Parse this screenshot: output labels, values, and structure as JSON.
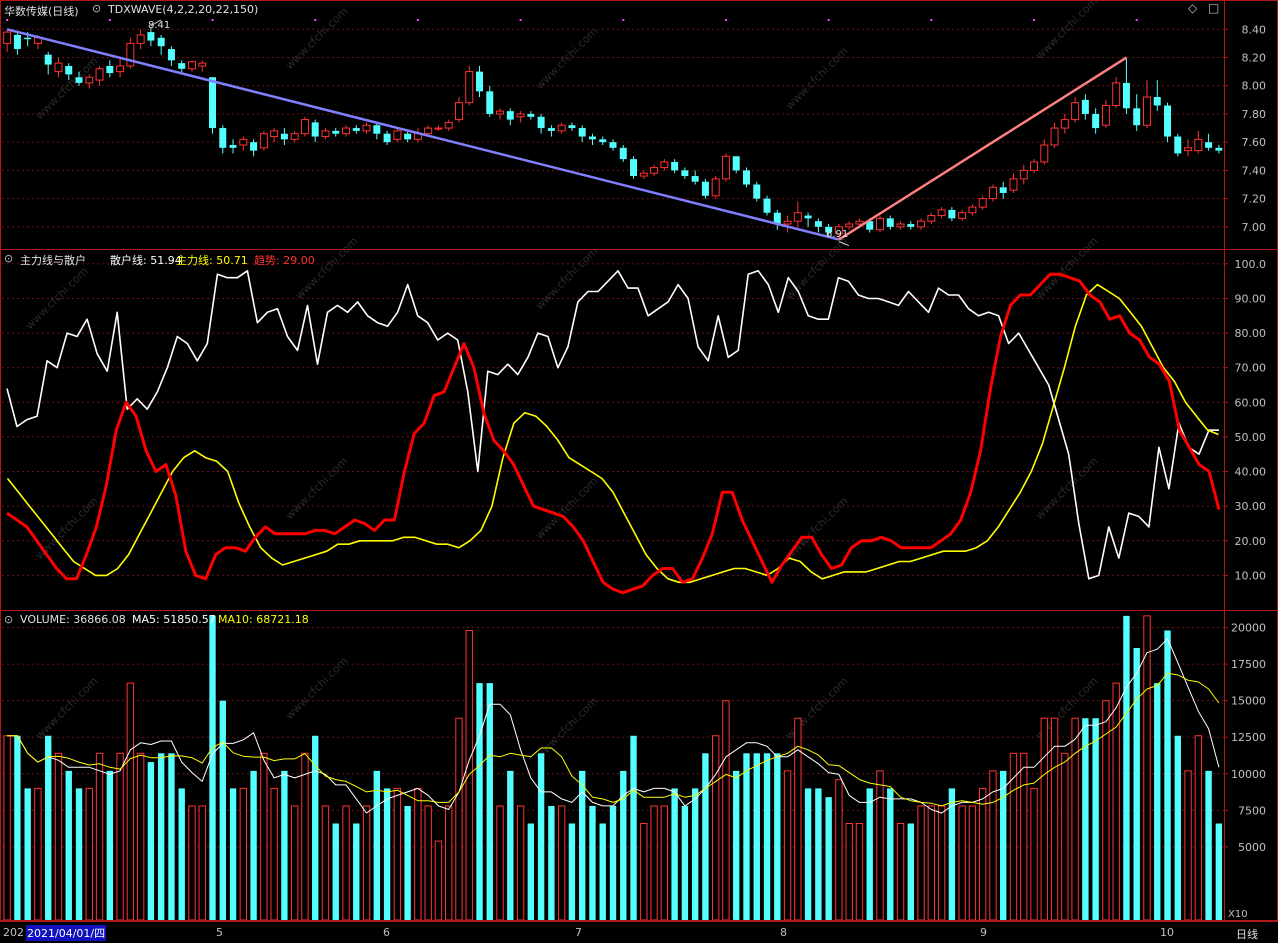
{
  "colors": {
    "up": "#ff3232",
    "down": "#54ffff",
    "bg": "#000000",
    "frame": "#b01818",
    "grid": "#6e1212",
    "axis_text": "#c0c0c0",
    "white_line": "#ffffff",
    "yellow_line": "#ffff00",
    "red_line": "#ff0000",
    "trend_down": "#8080ff",
    "trend_up": "#ff8080"
  },
  "panel_main": {
    "title": "华数传媒(日线)",
    "indicator": "TDXWAVE(4,2,2,20,22,150)",
    "high_label": "8.41",
    "low_label": "6.91",
    "y_ticks": [
      "8.40",
      "8.20",
      "8.00",
      "7.80",
      "7.60",
      "7.40",
      "7.20",
      "7.00"
    ]
  },
  "panel_ind": {
    "name": "主力线与散户",
    "s1_label": "散户线: 51.94",
    "s2_label": "主力线: 50.71",
    "s3_label": "趋势: 29.00",
    "y_ticks": [
      "100.0",
      "90.00",
      "80.00",
      "70.00",
      "60.00",
      "50.00",
      "40.00",
      "30.00",
      "20.00",
      "10.00"
    ]
  },
  "panel_vol": {
    "label": "VOLUME: 36866.08",
    "ma5_label": "MA5: 51850.57",
    "ma10_label": "MA10: 68721.18",
    "y_ticks": [
      "20000",
      "17500",
      "15000",
      "12500",
      "10000",
      "7500",
      "5000"
    ],
    "unit": "X10"
  },
  "x_axis": {
    "prefix": "202",
    "selected_date": "2021/04/01/四",
    "months": [
      "5",
      "6",
      "7",
      "8",
      "9",
      "10"
    ],
    "period": "日线"
  },
  "watermark": "www.cfchi.com",
  "chart_data": {
    "type": "candlestick",
    "candles": [
      [
        8.3,
        8.38,
        8.24,
        8.4
      ],
      [
        8.36,
        8.26,
        8.22,
        8.38
      ],
      [
        8.34,
        8.33,
        8.28,
        8.38
      ],
      [
        8.3,
        8.34,
        8.26,
        8.36
      ],
      [
        8.22,
        8.15,
        8.08,
        8.24
      ],
      [
        8.1,
        8.16,
        8.06,
        8.2
      ],
      [
        8.14,
        8.08,
        8.04,
        8.16
      ],
      [
        8.06,
        8.02,
        8.0,
        8.1
      ],
      [
        8.02,
        8.06,
        7.98,
        8.08
      ],
      [
        8.04,
        8.12,
        8.0,
        8.14
      ],
      [
        8.14,
        8.09,
        8.06,
        8.18
      ],
      [
        8.1,
        8.14,
        8.06,
        8.2
      ],
      [
        8.14,
        8.3,
        8.12,
        8.34
      ],
      [
        8.3,
        8.36,
        8.26,
        8.4
      ],
      [
        8.38,
        8.32,
        8.28,
        8.41
      ],
      [
        8.34,
        8.28,
        8.22,
        8.36
      ],
      [
        8.26,
        8.18,
        8.14,
        8.28
      ],
      [
        8.16,
        8.12,
        8.08,
        8.18
      ],
      [
        8.12,
        8.17,
        8.1,
        8.18
      ],
      [
        8.14,
        8.16,
        8.1,
        8.18
      ],
      [
        8.06,
        7.7,
        7.66,
        8.06
      ],
      [
        7.7,
        7.56,
        7.52,
        7.72
      ],
      [
        7.58,
        7.56,
        7.52,
        7.62
      ],
      [
        7.58,
        7.62,
        7.54,
        7.64
      ],
      [
        7.6,
        7.54,
        7.5,
        7.62
      ],
      [
        7.56,
        7.66,
        7.54,
        7.68
      ],
      [
        7.64,
        7.68,
        7.6,
        7.7
      ],
      [
        7.66,
        7.62,
        7.58,
        7.7
      ],
      [
        7.62,
        7.66,
        7.6,
        7.68
      ],
      [
        7.66,
        7.76,
        7.64,
        7.78
      ],
      [
        7.74,
        7.64,
        7.6,
        7.76
      ],
      [
        7.64,
        7.68,
        7.62,
        7.7
      ],
      [
        7.68,
        7.66,
        7.64,
        7.7
      ],
      [
        7.66,
        7.7,
        7.64,
        7.72
      ],
      [
        7.7,
        7.68,
        7.66,
        7.72
      ],
      [
        7.68,
        7.72,
        7.66,
        7.74
      ],
      [
        7.72,
        7.66,
        7.62,
        7.74
      ],
      [
        7.66,
        7.6,
        7.58,
        7.68
      ],
      [
        7.62,
        7.68,
        7.6,
        7.7
      ],
      [
        7.66,
        7.62,
        7.6,
        7.68
      ],
      [
        7.62,
        7.66,
        7.6,
        7.7
      ],
      [
        7.66,
        7.7,
        7.64,
        7.72
      ],
      [
        7.7,
        7.7,
        7.68,
        7.72
      ],
      [
        7.7,
        7.74,
        7.68,
        7.76
      ],
      [
        7.76,
        7.88,
        7.74,
        7.92
      ],
      [
        7.88,
        8.1,
        7.86,
        8.14
      ],
      [
        8.1,
        7.96,
        7.92,
        8.14
      ],
      [
        7.96,
        7.8,
        7.78,
        8.0
      ],
      [
        7.8,
        7.82,
        7.76,
        7.84
      ],
      [
        7.82,
        7.76,
        7.72,
        7.84
      ],
      [
        7.78,
        7.8,
        7.74,
        7.82
      ],
      [
        7.8,
        7.78,
        7.76,
        7.82
      ],
      [
        7.78,
        7.7,
        7.66,
        7.8
      ],
      [
        7.7,
        7.68,
        7.64,
        7.72
      ],
      [
        7.68,
        7.72,
        7.66,
        7.74
      ],
      [
        7.72,
        7.7,
        7.68,
        7.74
      ],
      [
        7.7,
        7.64,
        7.6,
        7.72
      ],
      [
        7.64,
        7.62,
        7.58,
        7.66
      ],
      [
        7.62,
        7.6,
        7.58,
        7.64
      ],
      [
        7.6,
        7.56,
        7.54,
        7.62
      ],
      [
        7.56,
        7.48,
        7.46,
        7.58
      ],
      [
        7.48,
        7.36,
        7.34,
        7.5
      ],
      [
        7.36,
        7.38,
        7.34,
        7.4
      ],
      [
        7.38,
        7.42,
        7.36,
        7.44
      ],
      [
        7.42,
        7.46,
        7.4,
        7.48
      ],
      [
        7.46,
        7.4,
        7.38,
        7.48
      ],
      [
        7.4,
        7.36,
        7.34,
        7.42
      ],
      [
        7.36,
        7.32,
        7.3,
        7.4
      ],
      [
        7.32,
        7.22,
        7.2,
        7.34
      ],
      [
        7.22,
        7.34,
        7.2,
        7.36
      ],
      [
        7.34,
        7.5,
        7.32,
        7.52
      ],
      [
        7.5,
        7.4,
        7.38,
        7.5
      ],
      [
        7.4,
        7.3,
        7.28,
        7.42
      ],
      [
        7.3,
        7.2,
        7.18,
        7.32
      ],
      [
        7.2,
        7.1,
        7.08,
        7.22
      ],
      [
        7.1,
        7.02,
        6.98,
        7.12
      ],
      [
        7.02,
        7.04,
        6.96,
        7.08
      ],
      [
        7.04,
        7.1,
        7.0,
        7.18
      ],
      [
        7.08,
        7.06,
        7.0,
        7.1
      ],
      [
        7.04,
        7.0,
        6.96,
        7.06
      ],
      [
        7.0,
        6.96,
        6.93,
        7.02
      ],
      [
        6.95,
        7.0,
        6.91,
        7.02
      ],
      [
        7.0,
        7.02,
        6.98,
        7.04
      ],
      [
        7.02,
        7.04,
        7.0,
        7.06
      ],
      [
        7.04,
        6.98,
        6.96,
        7.06
      ],
      [
        6.98,
        7.06,
        6.96,
        7.08
      ],
      [
        7.06,
        7.0,
        6.98,
        7.08
      ],
      [
        7.0,
        7.02,
        6.98,
        7.04
      ],
      [
        7.02,
        7.0,
        6.98,
        7.04
      ],
      [
        7.0,
        7.04,
        6.98,
        7.06
      ],
      [
        7.04,
        7.08,
        7.02,
        7.1
      ],
      [
        7.08,
        7.12,
        7.06,
        7.14
      ],
      [
        7.12,
        7.06,
        7.04,
        7.14
      ],
      [
        7.06,
        7.1,
        7.04,
        7.12
      ],
      [
        7.1,
        7.14,
        7.08,
        7.16
      ],
      [
        7.14,
        7.2,
        7.12,
        7.22
      ],
      [
        7.2,
        7.28,
        7.18,
        7.3
      ],
      [
        7.28,
        7.24,
        7.2,
        7.32
      ],
      [
        7.26,
        7.34,
        7.24,
        7.38
      ],
      [
        7.34,
        7.4,
        7.3,
        7.44
      ],
      [
        7.4,
        7.46,
        7.38,
        7.48
      ],
      [
        7.46,
        7.58,
        7.44,
        7.62
      ],
      [
        7.58,
        7.7,
        7.56,
        7.74
      ],
      [
        7.7,
        7.76,
        7.66,
        7.8
      ],
      [
        7.76,
        7.88,
        7.74,
        7.92
      ],
      [
        7.9,
        7.8,
        7.76,
        7.94
      ],
      [
        7.8,
        7.7,
        7.66,
        7.84
      ],
      [
        7.72,
        7.86,
        7.7,
        7.9
      ],
      [
        7.86,
        8.02,
        7.84,
        8.06
      ],
      [
        8.02,
        7.84,
        7.8,
        8.2
      ],
      [
        7.84,
        7.72,
        7.68,
        7.94
      ],
      [
        7.72,
        7.92,
        7.7,
        8.04
      ],
      [
        7.92,
        7.86,
        7.82,
        8.04
      ],
      [
        7.86,
        7.64,
        7.6,
        7.88
      ],
      [
        7.64,
        7.52,
        7.5,
        7.66
      ],
      [
        7.54,
        7.56,
        7.5,
        7.62
      ],
      [
        7.54,
        7.62,
        7.52,
        7.68
      ],
      [
        7.6,
        7.56,
        7.54,
        7.66
      ],
      [
        7.56,
        7.54,
        7.52,
        7.58
      ]
    ],
    "scatter_line": [
      64,
      53,
      55,
      56,
      72,
      70,
      80,
      79,
      84,
      74,
      69,
      86,
      58,
      61,
      58,
      63,
      70,
      79,
      77,
      72,
      77,
      97,
      96,
      96,
      98,
      83,
      86,
      87,
      79,
      75,
      88,
      71,
      86,
      88,
      86,
      89,
      85,
      83,
      82,
      86,
      94,
      85,
      83,
      78,
      80,
      78,
      63,
      40,
      69,
      68,
      71,
      68,
      73,
      80,
      79,
      70,
      76,
      89,
      92,
      92,
      95,
      98,
      93,
      93,
      85,
      87,
      89,
      94,
      90,
      76,
      72,
      85,
      73,
      75,
      97,
      98,
      94,
      86,
      96,
      92,
      85,
      84,
      84,
      96,
      95,
      91,
      90,
      90,
      89,
      88,
      92,
      89,
      86,
      93,
      91,
      91,
      87,
      85,
      86,
      85,
      77,
      80,
      75,
      70,
      65,
      55,
      45,
      25,
      9,
      10,
      24,
      15,
      28,
      27,
      24,
      47,
      35,
      54,
      47,
      45,
      52,
      51.94
    ],
    "main_line": [
      38,
      34,
      30,
      26,
      22,
      18,
      14,
      12,
      10,
      10,
      12,
      16,
      22,
      28,
      34,
      40,
      44,
      46,
      44,
      43,
      40,
      31,
      24,
      18,
      15,
      13,
      14,
      15,
      16,
      17,
      19,
      19,
      20,
      20,
      20,
      20,
      21,
      21,
      20,
      19,
      19,
      18,
      20,
      23,
      30,
      44,
      54,
      57,
      56,
      53,
      49,
      44,
      42,
      40,
      38,
      34,
      28,
      22,
      16,
      12,
      9,
      8,
      8,
      9,
      10,
      11,
      12,
      12,
      11,
      10,
      12,
      15,
      14,
      11,
      9,
      10,
      11,
      11,
      11,
      12,
      13,
      14,
      14,
      15,
      16,
      17,
      17,
      17,
      18,
      20,
      24,
      29,
      34,
      40,
      48,
      59,
      70,
      82,
      91,
      94,
      92,
      90,
      86,
      82,
      76,
      70,
      66,
      60,
      56,
      52,
      50.71
    ],
    "trend_line": [
      28,
      26,
      24,
      20,
      16,
      12,
      9,
      9,
      16,
      24,
      36,
      52,
      60,
      56,
      46,
      40,
      42,
      33,
      17,
      10,
      9,
      16,
      18,
      18,
      17,
      21,
      24,
      22,
      22,
      22,
      22,
      23,
      23,
      22,
      24,
      26,
      25,
      23,
      26,
      26,
      40,
      51,
      54,
      62,
      63,
      70,
      77,
      70,
      57,
      49,
      46,
      42,
      36,
      30,
      29,
      28,
      27,
      24,
      20,
      14,
      8,
      6,
      5,
      6,
      7,
      10,
      12,
      12,
      8,
      9,
      15,
      22,
      34,
      34,
      26,
      20,
      14,
      8,
      13,
      17,
      21,
      21,
      16,
      12,
      13,
      18,
      20,
      20,
      21,
      20,
      18,
      18,
      18,
      18,
      20,
      22,
      26,
      34,
      46,
      64,
      79,
      88,
      91,
      91,
      94,
      97,
      97,
      96,
      95,
      91,
      89,
      84,
      85,
      80,
      78,
      73,
      71,
      66,
      52,
      47,
      42,
      40,
      29
    ]
  }
}
